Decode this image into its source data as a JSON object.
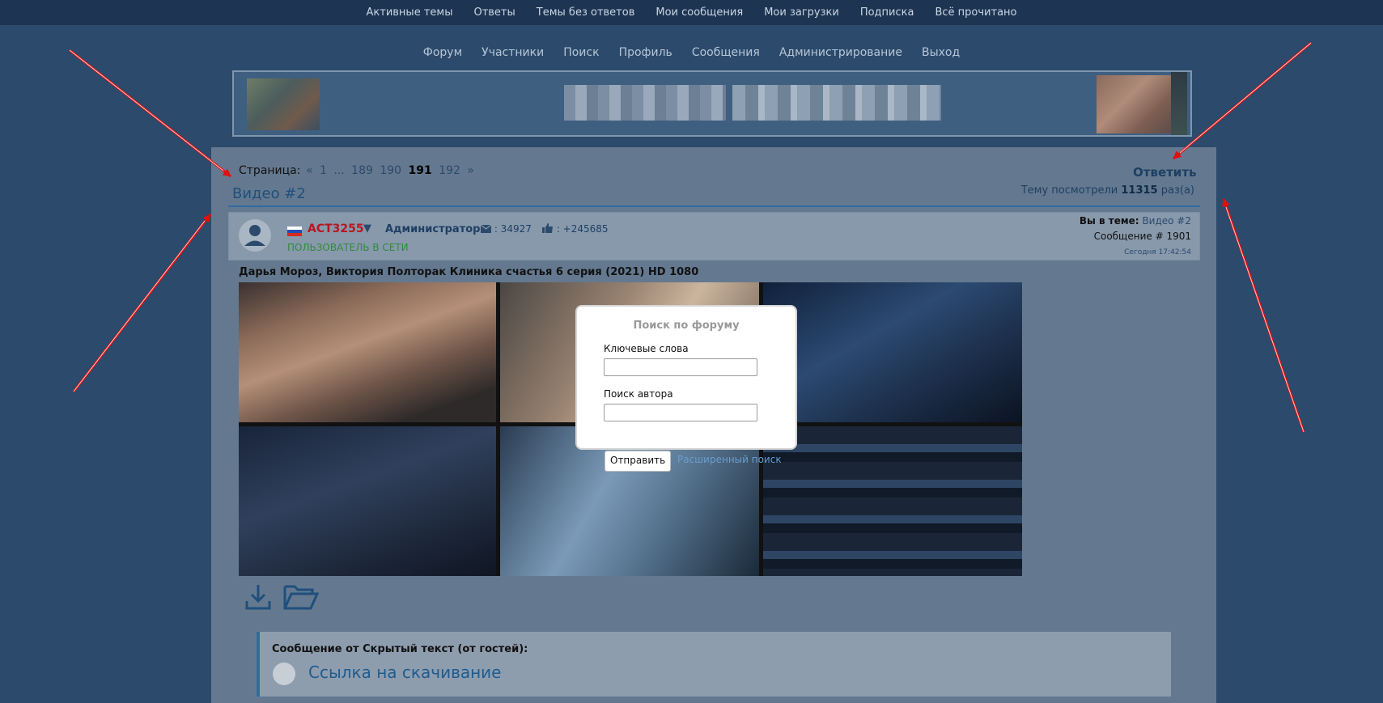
{
  "topbar": {
    "links": [
      "Активные темы",
      "Ответы",
      "Темы без ответов",
      "Мои сообщения",
      "Мои загрузки",
      "Подписка",
      "Всё прочитано"
    ]
  },
  "nav": {
    "links": [
      "Форум",
      "Участники",
      "Поиск",
      "Профиль",
      "Сообщения",
      "Администрирование",
      "Выход"
    ]
  },
  "pagination": {
    "label": "Страница:",
    "prev": "«",
    "first": "1",
    "dots": "...",
    "p189": "189",
    "p190": "190",
    "current": "191",
    "p192": "192",
    "next": "»"
  },
  "topic": {
    "title": "Видео #2",
    "reply": "Ответить",
    "views_prefix": "Тему посмотрели",
    "views": "11315",
    "views_suffix": "раз(а)"
  },
  "post": {
    "username": "ACT3255",
    "caret": "▼",
    "role": "Администратор",
    "mails": ": 34927",
    "likes": ": +245685",
    "online": "ПОЛЬЗОВАТЕЛЬ В СЕТИ",
    "in_topic_label": "Вы в теме:",
    "in_topic_link": "Видео #2",
    "message_no": "Сообщение # 1901",
    "time": "Сегодня 17:42:54",
    "title": "Дарья Мороз, Виктория Полторак Клиника счастья 6 серия (2021) HD 1080"
  },
  "quote": {
    "header": "Сообщение от Скрытый текст (от гостей):",
    "link": "Ссылка на скачивание"
  },
  "modal": {
    "title": "Поиск по форуму",
    "keywords_label": "Ключевые слова",
    "author_label": "Поиск автора",
    "submit": "Отправить",
    "advanced": "Расширенный поиск"
  },
  "colors": {
    "background": "#2c4a6b",
    "topbar": "#1d3552",
    "content": "#64798f",
    "username": "#b8161f",
    "online": "#2f8b3d",
    "arrow": "#e01010"
  }
}
